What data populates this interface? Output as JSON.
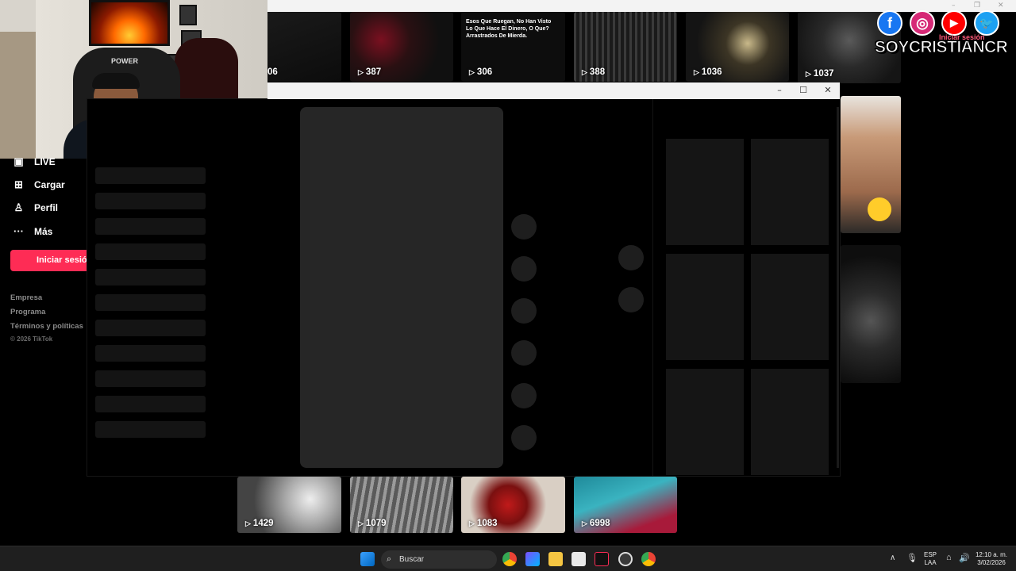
{
  "browser": {
    "minimize": "–",
    "restore": "❐",
    "close": "✕"
  },
  "grid_top": [
    {
      "views": "06"
    },
    {
      "views": "387"
    },
    {
      "views": "306",
      "caption": "Esos Que Ruegan, No Han Visto Lo Que Hace El Dinero, O Que? Arrastrados De Mierda."
    },
    {
      "views": "388"
    },
    {
      "views": "1036"
    },
    {
      "views": "1037"
    }
  ],
  "grid_bottom": [
    {
      "views": "1429"
    },
    {
      "views": "1079"
    },
    {
      "views": "1083"
    },
    {
      "views": "6998"
    }
  ],
  "sidebar": {
    "items": [
      {
        "label": "LIVE",
        "icon": "live-icon"
      },
      {
        "label": "Cargar",
        "icon": "upload-icon"
      },
      {
        "label": "Perfil",
        "icon": "profile-icon"
      },
      {
        "label": "Más",
        "icon": "more-icon"
      }
    ],
    "login_label": "Iniciar sesión",
    "footer": [
      "Empresa",
      "Programa",
      "Términos y políticas"
    ],
    "copyright": "© 2026 TikTok"
  },
  "modal": {
    "minimize": "–",
    "maximize": "☐",
    "close": "✕"
  },
  "overlay": {
    "socials": [
      {
        "name": "facebook-icon",
        "glyph": "f",
        "color": "#1877f2"
      },
      {
        "name": "instagram-icon",
        "glyph": "◎",
        "color": "#d62976"
      },
      {
        "name": "youtube-icon",
        "glyph": "▶",
        "color": "#ff0000"
      },
      {
        "name": "twitter-icon",
        "glyph": "🐦",
        "color": "#1da1f2"
      }
    ],
    "brand": "SOYCRISTIANCR",
    "login_hint": "Iniciar sesión"
  },
  "taskbar": {
    "search_placeholder": "Buscar",
    "lang_top": "ESP",
    "lang_bottom": "LAA",
    "time": "12:10 a. m.",
    "date": "3/02/2026"
  }
}
